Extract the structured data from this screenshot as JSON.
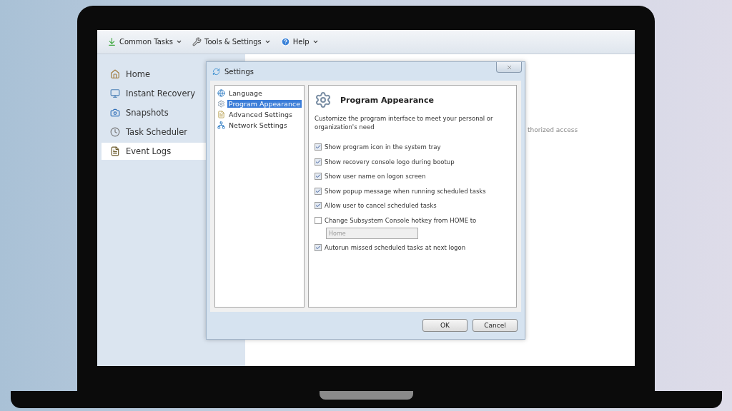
{
  "toolbar": {
    "menus": [
      {
        "label": "Common Tasks",
        "kind": "tasks"
      },
      {
        "label": "Tools & Settings",
        "kind": "tools"
      },
      {
        "label": "Help",
        "kind": "help"
      }
    ]
  },
  "sidebar": {
    "items": [
      {
        "label": "Home",
        "kind": "home",
        "selected": false
      },
      {
        "label": "Instant Recovery",
        "kind": "recovery",
        "selected": false
      },
      {
        "label": "Snapshots",
        "kind": "snapshots",
        "selected": false
      },
      {
        "label": "Task Scheduler",
        "kind": "scheduler",
        "selected": false
      },
      {
        "label": "Event Logs",
        "kind": "logs",
        "selected": true
      }
    ]
  },
  "content": {
    "text": "thorized access"
  },
  "dialog": {
    "title": "Settings",
    "tree": [
      {
        "label": "Language",
        "kind": "language",
        "selected": false
      },
      {
        "label": "Program Appearance",
        "kind": "appearance",
        "selected": true
      },
      {
        "label": "Advanced Settings",
        "kind": "advanced",
        "selected": false
      },
      {
        "label": "Network Settings",
        "kind": "network",
        "selected": false
      }
    ],
    "heading": "Program Appearance",
    "description": "Customize the program interface to meet your personal or organization's need",
    "options": [
      {
        "kind": "checkbox",
        "label": "Show program icon in the system tray",
        "checked": true
      },
      {
        "kind": "checkbox",
        "label": "Show recovery console logo during bootup",
        "checked": true
      },
      {
        "kind": "checkbox",
        "label": "Show user name on logon screen",
        "checked": true
      },
      {
        "kind": "checkbox",
        "label": "Show popup message when running scheduled tasks",
        "checked": true
      },
      {
        "kind": "checkbox",
        "label": "Allow user to cancel scheduled tasks",
        "checked": true
      },
      {
        "kind": "checkbox",
        "label": "Change Subsystem Console hotkey from HOME to",
        "checked": false
      },
      {
        "kind": "field",
        "value": "Home",
        "disabled": true
      },
      {
        "kind": "checkbox",
        "label": "Autorun missed scheduled tasks at next logon",
        "checked": true
      }
    ],
    "buttons": [
      "OK",
      "Cancel"
    ]
  }
}
